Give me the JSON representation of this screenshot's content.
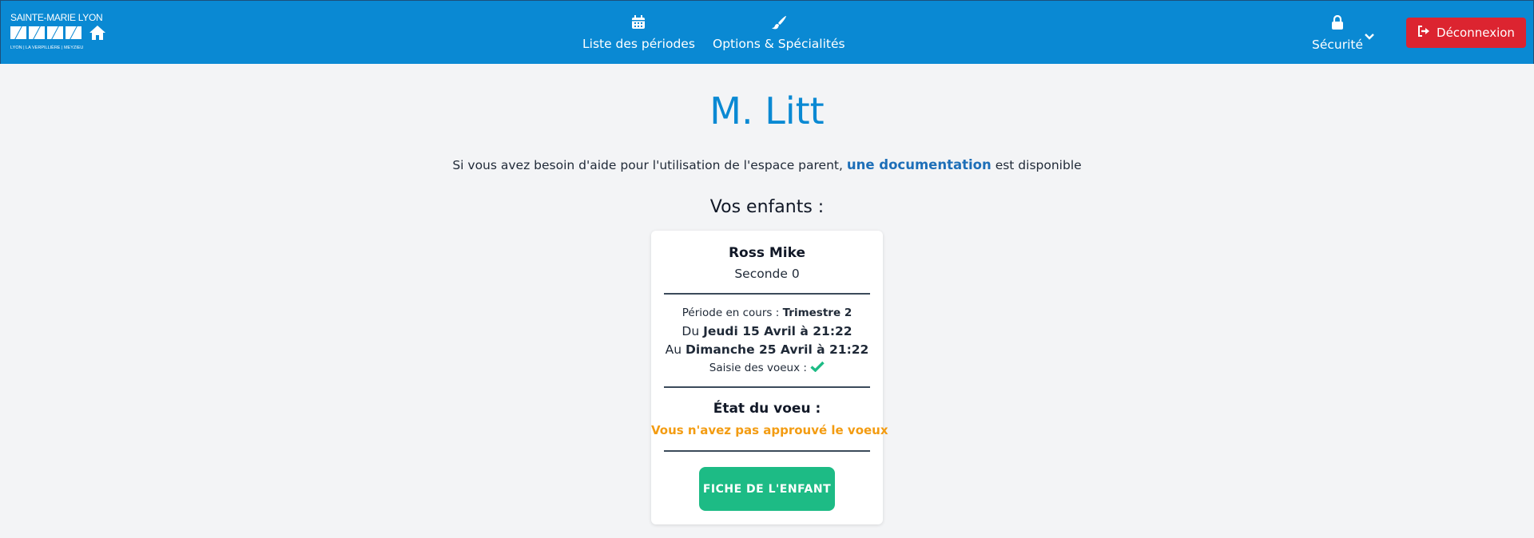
{
  "brand": {
    "title": "SAINTE-MARIE LYON",
    "subtitle": "LYON | LA VERPILLIÈRE | MEYZIEU"
  },
  "nav": {
    "periods_label": "Liste des périodes",
    "options_label": "Options & Spécialités",
    "security_label": "Sécurité",
    "logout_label": "Déconnexion"
  },
  "page": {
    "title": "M. Litt",
    "help_prefix": "Si vous avez besoin d'aide pour l'utilisation de l'espace parent,",
    "help_link": "une documentation",
    "help_suffix": "est disponible",
    "children_title": "Vos enfants :"
  },
  "child": {
    "name": "Ross Mike",
    "class": "Seconde 0",
    "period_label": "Période en cours :",
    "period_value": "Trimestre 2",
    "from_label": "Du",
    "from_value": "Jeudi 15 Avril à 21:22",
    "to_label": "Au",
    "to_value": "Dimanche 25 Avril à 21:22",
    "saisie_label": "Saisie des voeux :",
    "state_title": "État du voeu :",
    "state_value": "Vous n'avez pas approuvé le voeux",
    "button_label": "FICHE DE L'ENFANT"
  },
  "colors": {
    "navbar": "#0a89d3",
    "logout": "#dc2430",
    "button": "#1dbb85",
    "warning": "#f39c12",
    "check": "#1dbb85"
  }
}
